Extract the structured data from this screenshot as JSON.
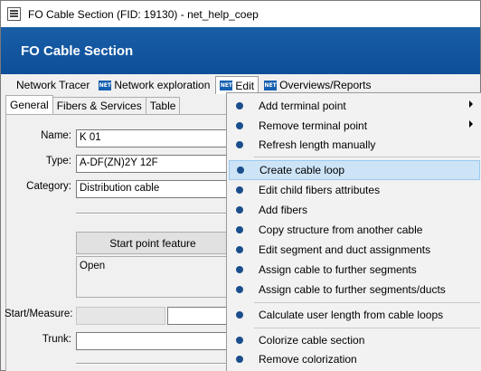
{
  "window": {
    "title": "FO Cable Section (FID: 19130) - net_help_coep"
  },
  "header": {
    "title": "FO Cable Section"
  },
  "menubar": {
    "items": [
      {
        "label": "Network Tracer",
        "icon": null
      },
      {
        "label": "Network exploration",
        "icon": "net-icon"
      },
      {
        "label": "Edit",
        "icon": "net-icon",
        "active": true
      },
      {
        "label": "Overviews/Reports",
        "icon": "net-icon"
      }
    ],
    "net_badge": "NET"
  },
  "tabs": [
    {
      "label": "General",
      "selected": true
    },
    {
      "label": "Fibers & Services"
    },
    {
      "label": "Table"
    }
  ],
  "form": {
    "name_label": "Name:",
    "name_value": "K 01",
    "type_label": "Type:",
    "type_value": "A-DF(ZN)2Y 12F",
    "category_label": "Category:",
    "category_value": "Distribution cable",
    "start_point_button": "Start point feature",
    "start_point_value": "Open",
    "start_measure_label": "Start/Measure:",
    "trunk_label": "Trunk:"
  },
  "edit_menu": {
    "items": [
      {
        "label": "Add terminal point",
        "submenu": true
      },
      {
        "label": "Remove terminal point",
        "submenu": true
      },
      {
        "label": "Refresh length manually"
      },
      {
        "label": "Create cable loop",
        "highlighted": true
      },
      {
        "label": "Edit child fibers attributes"
      },
      {
        "label": "Add fibers"
      },
      {
        "label": "Copy structure from another cable"
      },
      {
        "label": "Edit segment and duct assignments"
      },
      {
        "label": "Assign cable to further segments"
      },
      {
        "label": "Assign cable to further segments/ducts"
      },
      {
        "label": "Calculate user length from cable loops"
      },
      {
        "label": "Colorize cable section"
      },
      {
        "label": "Remove colorization"
      }
    ]
  },
  "colors": {
    "header_bg": "#0d4f99",
    "highlight": "#cde4f7",
    "bullet": "#1a4e8c"
  }
}
